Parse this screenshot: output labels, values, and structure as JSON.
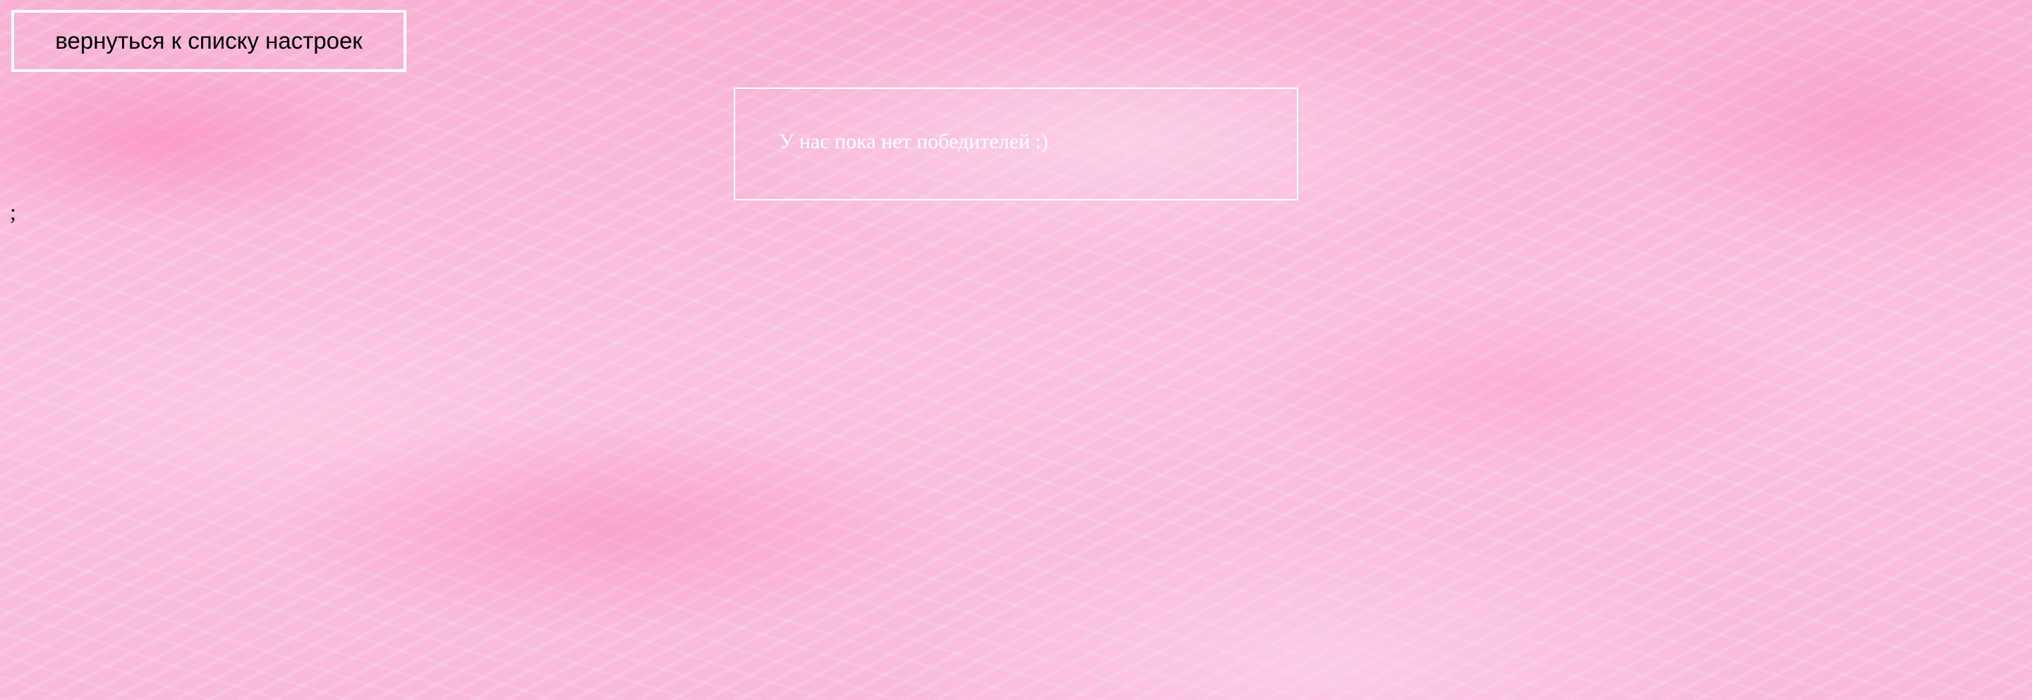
{
  "nav": {
    "back_label": "вернуться к списку настроек"
  },
  "winners": {
    "empty_message": "У нас пока нет победителей :)"
  },
  "stray_text": ";"
}
